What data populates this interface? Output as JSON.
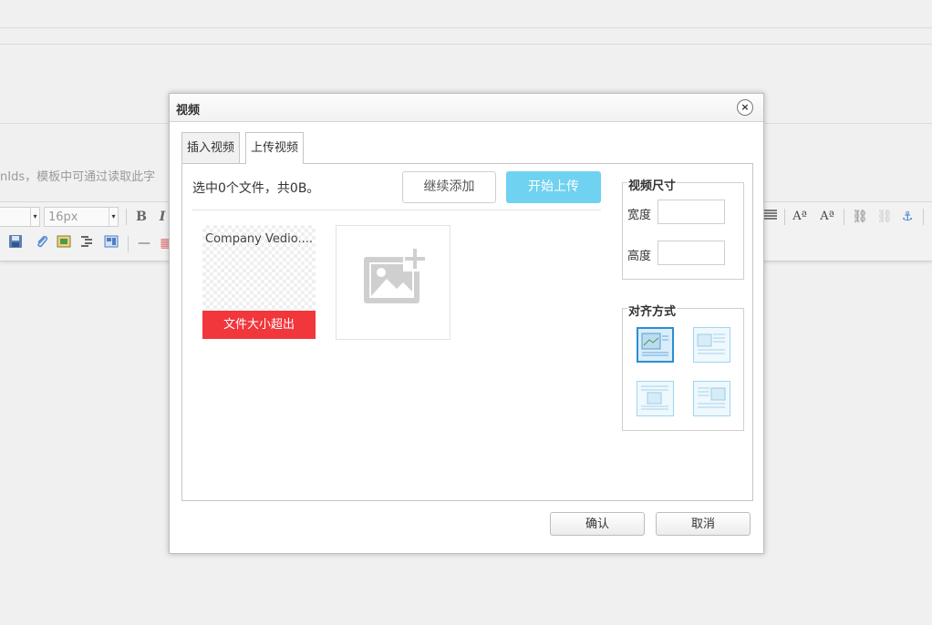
{
  "background": {
    "hint_text": "nIds，模板中可通过读取此字",
    "toolbar": {
      "font_select": "",
      "size_select": "16px",
      "bold_label": "B",
      "italic_label": "I"
    }
  },
  "dialog": {
    "title": "视频",
    "close_label": "×",
    "tabs": [
      {
        "label": "插入视频",
        "active": false
      },
      {
        "label": "上传视频",
        "active": true
      }
    ],
    "upload": {
      "status_text": "选中0个文件，共0B。",
      "continue_button": "继续添加",
      "start_button": "开始上传",
      "files": [
        {
          "name": "Company Vedio....",
          "error": "文件大小超出"
        }
      ],
      "add_file_icon": "add-image-icon"
    },
    "size_section": {
      "legend": "视频尺寸",
      "width_label": "宽度",
      "width_value": "",
      "height_label": "高度",
      "height_value": ""
    },
    "align_section": {
      "legend": "对齐方式",
      "options": [
        "none",
        "left",
        "right",
        "center"
      ],
      "selected": "none"
    },
    "footer": {
      "confirm": "确认",
      "cancel": "取消"
    }
  },
  "colors": {
    "upload_button": "#6fd2f0",
    "error_bar": "#f1363c",
    "align_selected": "#2d8ed1"
  }
}
